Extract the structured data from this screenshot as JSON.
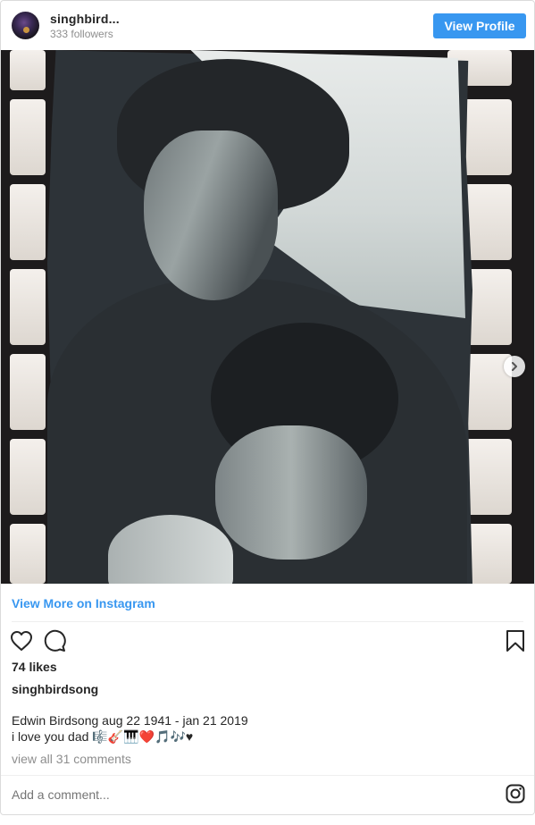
{
  "header": {
    "username": "singhbird...",
    "followers": "333 followers",
    "view_profile_label": "View Profile"
  },
  "post": {
    "view_more_label": "View More on Instagram",
    "likes": "74 likes",
    "caption_user": "singhbirdsong",
    "caption_line1": "Edwin Birdsong aug 22 1941 - jan 21 2019",
    "caption_line2": "i love you dad 🎼🎸🎹❤️🎵🎶♥",
    "view_comments": "view all 31 comments",
    "comment_placeholder": "Add a comment..."
  },
  "colors": {
    "accent": "#3897f0",
    "muted": "#8e8e8e",
    "text": "#262626"
  },
  "icons": [
    "heart-icon",
    "comment-icon",
    "bookmark-icon",
    "chevron-right-icon",
    "instagram-icon"
  ]
}
